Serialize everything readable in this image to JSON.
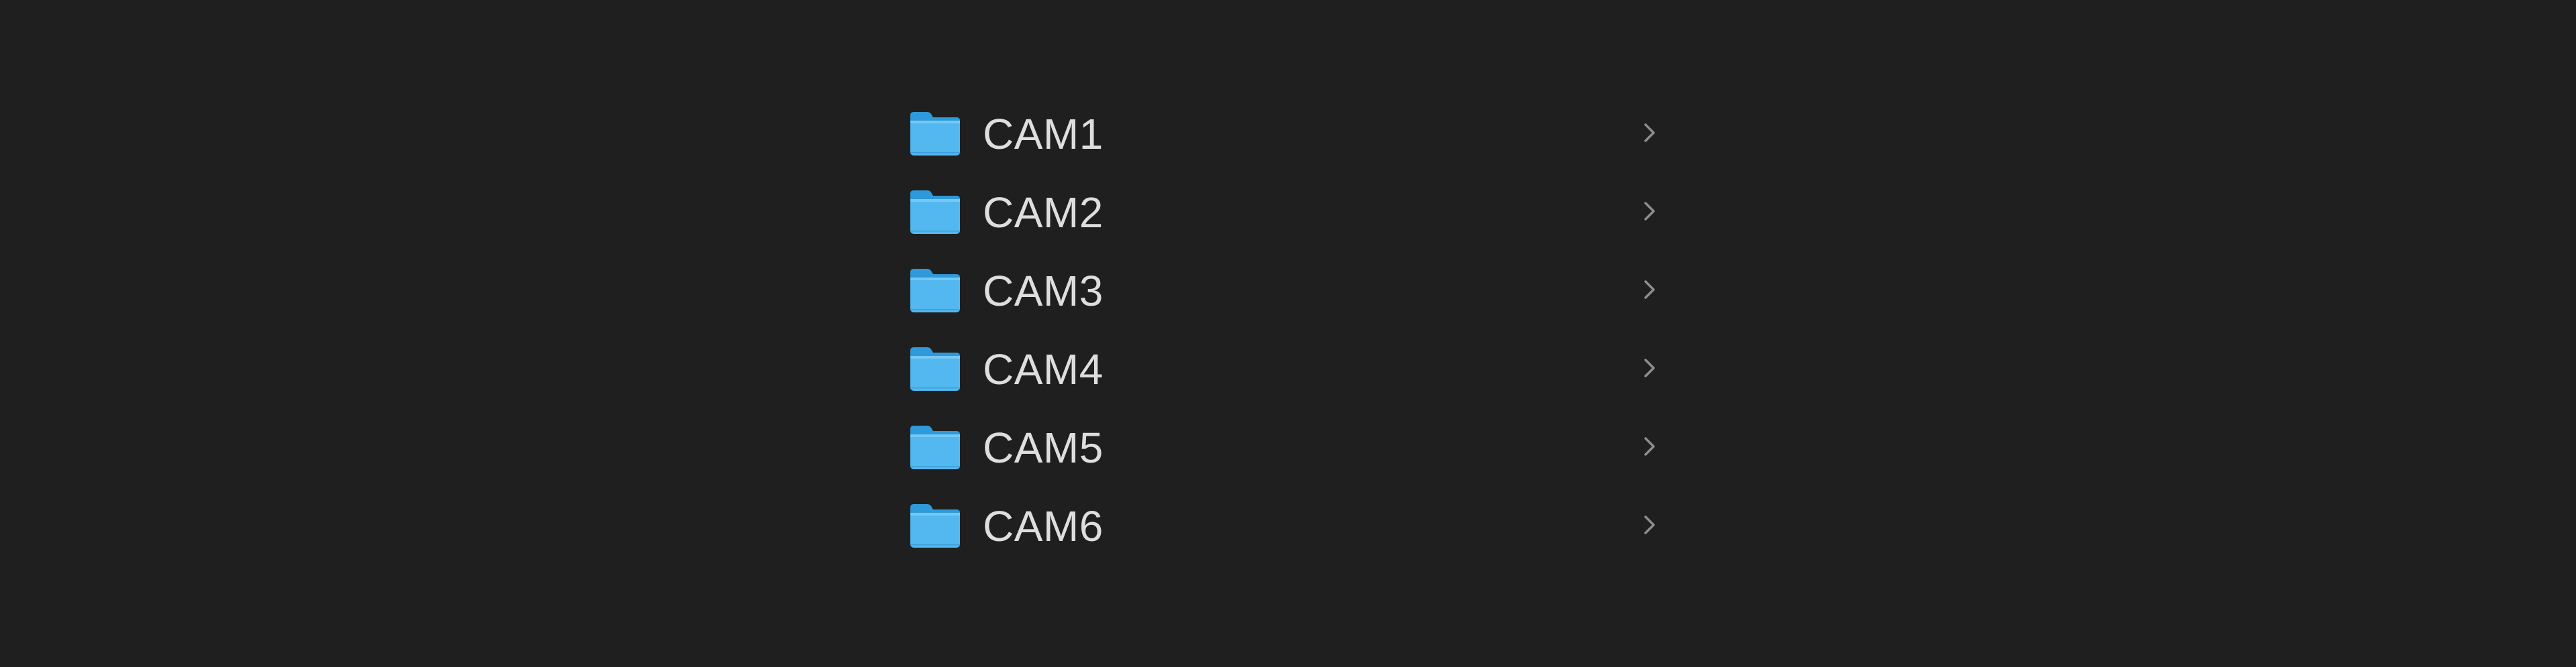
{
  "window": {
    "background": "#1f1f1f"
  },
  "finder_column": {
    "items": [
      {
        "name": "CAM1",
        "icon": "folder-icon",
        "disclosure_icon": "chevron-right-icon"
      },
      {
        "name": "CAM2",
        "icon": "folder-icon",
        "disclosure_icon": "chevron-right-icon"
      },
      {
        "name": "CAM3",
        "icon": "folder-icon",
        "disclosure_icon": "chevron-right-icon"
      },
      {
        "name": "CAM4",
        "icon": "folder-icon",
        "disclosure_icon": "chevron-right-icon"
      },
      {
        "name": "CAM5",
        "icon": "folder-icon",
        "disclosure_icon": "chevron-right-icon"
      },
      {
        "name": "CAM6",
        "icon": "folder-icon",
        "disclosure_icon": "chevron-right-icon"
      }
    ]
  },
  "colors": {
    "folder_blue": "#4fb6ee",
    "folder_blue_dark": "#2b98d8",
    "text": "#dedede",
    "chevron": "#8e8e8e"
  }
}
